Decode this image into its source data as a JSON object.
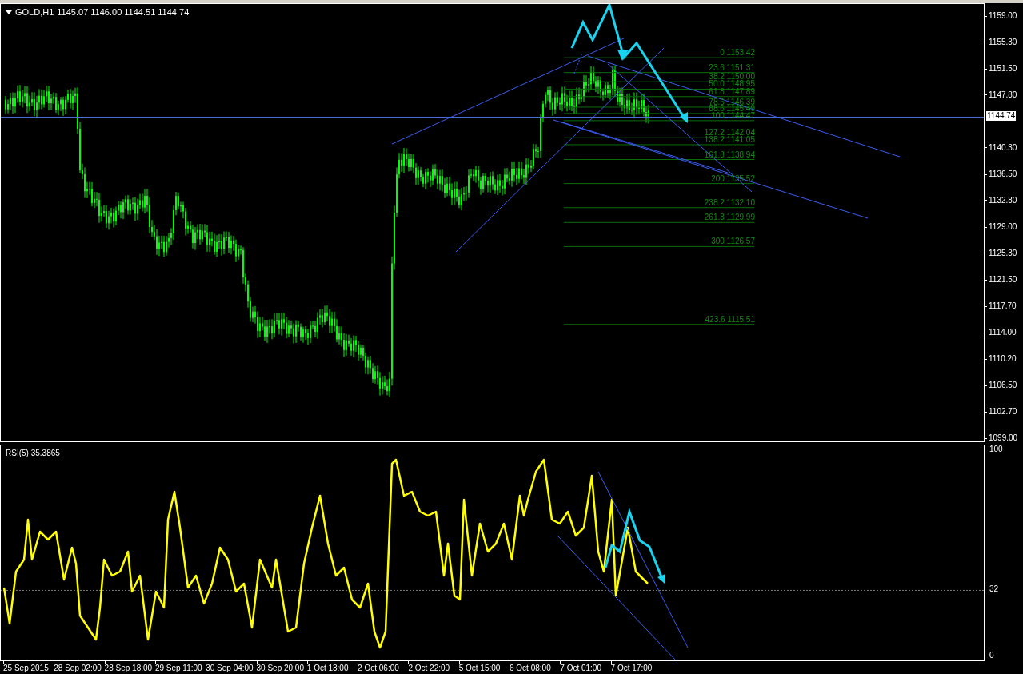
{
  "header": {
    "symbol": "GOLD,H1",
    "ohlc": "1145.07 1146.00 1144.51 1144.74"
  },
  "price_axis": {
    "labels": [
      "1159.00",
      "1155.30",
      "1151.50",
      "1147.80",
      "1140.30",
      "1136.50",
      "1132.80",
      "1129.00",
      "1125.30",
      "1121.50",
      "1117.70",
      "1114.00",
      "1110.20",
      "1106.50",
      "1102.70",
      "1099.00"
    ],
    "current_price": "1144.74"
  },
  "fibonacci": {
    "levels": [
      "0 1153.42",
      "23.6 1151.31",
      "38.2 1150.00",
      "50.0 1148.95",
      "61.8 1147.89",
      "78.6 1146.39",
      "88.6 1145.49",
      "100 1144.47",
      "127.2 1142.04",
      "138.2 1141.05",
      "161.8 1138.94",
      "200 1135.52",
      "238.2 1132.10",
      "261.8 1129.99",
      "300 1126.57",
      "423.6 1115.51"
    ]
  },
  "indicator": {
    "label": "RSI(5) 35.3865",
    "axis_labels": [
      "100",
      "32",
      "0"
    ]
  },
  "time_axis": {
    "labels": [
      "25 Sep 2015",
      "28 Sep 02:00",
      "28 Sep 18:00",
      "29 Sep 11:00",
      "30 Sep 04:00",
      "30 Sep 20:00",
      "1 Oct 13:00",
      "2 Oct 06:00",
      "2 Oct 22:00",
      "5 Oct 15:00",
      "6 Oct 08:00",
      "7 Oct 01:00",
      "7 Oct 17:00"
    ]
  }
}
